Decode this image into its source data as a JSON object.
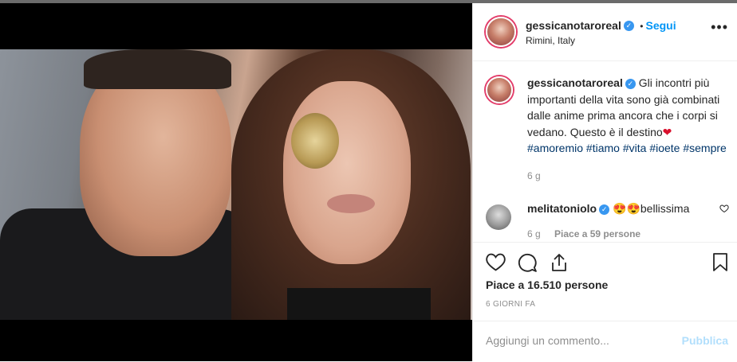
{
  "post": {
    "username": "gessicanotaroreal",
    "follow_label": "Segui",
    "separator": "•",
    "location": "Rimini, Italy",
    "more_label": "•••"
  },
  "caption": {
    "username": "gessicanotaroreal",
    "text": "Gli incontri più importanti della vita sono già combinati dalle anime prima ancora che i corpi si vedano. Questo è il destino",
    "heart": "❤",
    "hashtags": [
      "#amoremio",
      "#tiamo",
      "#vita",
      "#ioete",
      "#sempre"
    ],
    "time": "6 g"
  },
  "comment": {
    "username": "melitatoniolo",
    "emojis": "😍😍",
    "text": "bellissima",
    "time": "6 g",
    "likes": "Piace a 59 persone"
  },
  "likes_label": "Piace a 16.510 persone",
  "age_label": "6 GIORNI FA",
  "comment_bar": {
    "placeholder": "Aggiungi un commento...",
    "publish_label": "Pubblica"
  },
  "colors": {
    "link": "#0095f6",
    "hashtag": "#003569",
    "muted": "#8e8e8e",
    "verified": "#3897f0"
  }
}
